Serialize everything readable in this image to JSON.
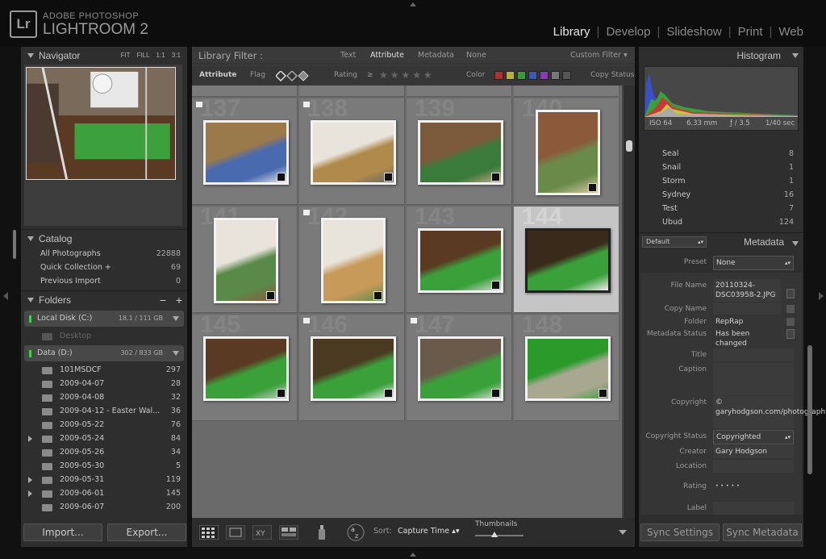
{
  "app": {
    "brand_top": "ADOBE PHOTOSHOP",
    "brand_main": "LIGHTROOM 2",
    "logo": "Lr"
  },
  "modules": [
    "Library",
    "Develop",
    "Slideshow",
    "Print",
    "Web"
  ],
  "navigator": {
    "title": "Navigator",
    "zoom_options": [
      "FIT",
      "FILL",
      "1:1",
      "3:1"
    ]
  },
  "catalog": {
    "title": "Catalog",
    "items": [
      {
        "label": "All Photographs",
        "count": "22888"
      },
      {
        "label": "Quick Collection +",
        "count": "69"
      },
      {
        "label": "Previous Import",
        "count": "0"
      }
    ]
  },
  "folders": {
    "title": "Folders",
    "disks": [
      {
        "label": "Local Disk (C:)",
        "capacity": "18.1 / 111 GB"
      },
      {
        "label": "Data (D:)",
        "capacity": "302 / 833 GB"
      }
    ],
    "desktop": "Desktop",
    "items": [
      {
        "label": "101MSDCF",
        "count": "297"
      },
      {
        "label": "2009-04-07",
        "count": "28"
      },
      {
        "label": "2009-04-08",
        "count": "32"
      },
      {
        "label": "2009-04-12 - Easter Wal...",
        "count": "36"
      },
      {
        "label": "2009-05-22",
        "count": "76"
      },
      {
        "label": "2009-05-24",
        "count": "84"
      },
      {
        "label": "2009-05-26",
        "count": "34"
      },
      {
        "label": "2009-05-30",
        "count": "5"
      },
      {
        "label": "2009-05-31",
        "count": "119"
      },
      {
        "label": "2009-06-01",
        "count": "145"
      },
      {
        "label": "2009-06-07",
        "count": "200"
      }
    ]
  },
  "left_buttons": {
    "import": "Import...",
    "export": "Export..."
  },
  "filter": {
    "title": "Library Filter :",
    "tabs": [
      "Text",
      "Attribute",
      "Metadata",
      "None"
    ],
    "custom": "Custom Filter ▾",
    "row2": {
      "attribute": "Attribute",
      "flag": "Flag",
      "rating": "Rating",
      "rating_op": "≥",
      "color": "Color",
      "copy": "Copy Status"
    },
    "colors": [
      "#b03030",
      "#b8b030",
      "#3a9a3a",
      "#3a5ab0",
      "#8a3ab0",
      "#777777",
      "#555555"
    ]
  },
  "grid": {
    "cells": [
      {
        "num": "",
        "flag": false
      },
      {
        "num": "",
        "flag": false
      },
      {
        "num": "",
        "flag": false
      },
      {
        "num": "",
        "flag": false
      },
      {
        "num": "137",
        "flag": true
      },
      {
        "num": "138",
        "flag": true
      },
      {
        "num": "139",
        "flag": false
      },
      {
        "num": "140",
        "flag": false
      },
      {
        "num": "141",
        "flag": false
      },
      {
        "num": "142",
        "flag": true
      },
      {
        "num": "143",
        "flag": false
      },
      {
        "num": "144",
        "flag": false
      },
      {
        "num": "145",
        "flag": false
      },
      {
        "num": "146",
        "flag": true
      },
      {
        "num": "147",
        "flag": true
      },
      {
        "num": "148",
        "flag": false
      }
    ]
  },
  "toolbar": {
    "sort_label": "Sort:",
    "sort_value": "Capture Time",
    "thumbnails": "Thumbnails"
  },
  "histogram": {
    "title": "Histogram",
    "iso": "ISO 64",
    "focal": "6.33 mm",
    "aperture": "ƒ / 3.5",
    "shutter": "1/40 sec"
  },
  "keywords": [
    {
      "label": "Seal",
      "count": "8"
    },
    {
      "label": "Snail",
      "count": "1"
    },
    {
      "label": "Storm",
      "count": "1"
    },
    {
      "label": "Sydney",
      "count": "16"
    },
    {
      "label": "Test",
      "count": "7"
    },
    {
      "label": "Ubud",
      "count": "124"
    }
  ],
  "metadata": {
    "title": "Metadata",
    "preset_select": "Default",
    "fields": {
      "preset_label": "Preset",
      "preset_value": "None",
      "file_name_label": "File Name",
      "file_name_value": "20110324-DSC03958-2.JPG",
      "copy_name_label": "Copy Name",
      "copy_name_value": "",
      "folder_label": "Folder",
      "folder_value": "RepRap",
      "status_label": "Metadata Status",
      "status_value": "Has been changed",
      "title_label": "Title",
      "caption_label": "Caption",
      "copyright_label": "Copyright",
      "copyright_value": "© garyhodgson.com/photography",
      "copyright_status_label": "Copyright Status",
      "copyright_status_value": "Copyrighted",
      "creator_label": "Creator",
      "creator_value": "Gary Hodgson",
      "location_label": "Location",
      "rating_label": "Rating",
      "rating_value": "·  ·  ·  ·  ·",
      "label_label": "Label"
    }
  },
  "right_buttons": {
    "sync_settings": "Sync Settings",
    "sync_metadata": "Sync Metadata"
  }
}
